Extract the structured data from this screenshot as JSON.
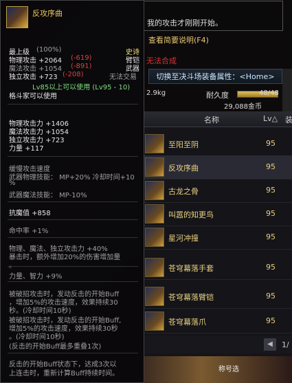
{
  "info_panel": {
    "tooltip_text": "我的攻击才刚刚开始。",
    "view_summary": "查看简要说明(F4)",
    "cannot_synth": "无法合成",
    "switch_button": "切换至决斗场装备属性：<Home>",
    "weight": "2.9kg",
    "durability_label": "耐久度",
    "durability_value": "48/48",
    "durability_fraction": 1.0,
    "price": "29,088金币"
  },
  "list": {
    "col_name": "名称",
    "col_lv": "Lv△",
    "col_extra": "装",
    "items": [
      {
        "name": "至阳至阴",
        "lv": "95"
      },
      {
        "name": "反攻序曲",
        "lv": "95"
      },
      {
        "name": "古龙之骨",
        "lv": "95"
      },
      {
        "name": "叫嚣的知更鸟",
        "lv": "95"
      },
      {
        "name": "星河冲撞",
        "lv": "95"
      },
      {
        "name": "苍穹幕落手套",
        "lv": "95"
      },
      {
        "name": "苍穹幕落臂铠",
        "lv": "95"
      },
      {
        "name": "苍穹幕落爪",
        "lv": "95"
      }
    ],
    "pager_prev": "◀",
    "page": "1/",
    "tab_label": "称号选"
  },
  "tooltip": {
    "title": "反攻序曲",
    "grade": "最上级",
    "grade_pct": "(100%)",
    "rarity": "史诗",
    "type1": "臂铠",
    "type2": "武器",
    "trade": "无法交易",
    "phys_atk": "物理攻击 +2064",
    "phys_atk_diff": "(-619)",
    "mag_atk": "魔法攻击 +1054",
    "mag_atk_diff": "(-891)",
    "ind_atk": "独立攻击 +723",
    "ind_atk_diff": "(-208)",
    "level_req": "Lv85以上可以使用 (Lv95 - 10)",
    "class_req": "格斗家可以使用",
    "stat1": "物理攻击力 +1406",
    "stat2": "魔法攻击力 +1054",
    "stat3": "独立攻击力 +723",
    "stat4": "力量 +117",
    "slow_speed": "缓慢攻击速度",
    "skill_line1": "武器物理技能： MP+20% 冷却时间+10",
    "skill_line1b": "%",
    "skill_line2": "武器魔法技能： MP-10%",
    "res": "抗魔值 +858",
    "hit": "命中率 +1%",
    "atk_up": "物理、魔法、独立攻击力 +40%",
    "crit": "暴击时，额外增加20%的伤害增加量",
    "crit2": "。",
    "str_int": "力量、智力 +9%",
    "eff1": "被破招攻击时，发动反击的开始Buff",
    "eff2": "，增加5%的攻击速度，效果持续30",
    "eff3": "秒。(冷却时间10秒)",
    "eff4": "被破招攻击时，发动反击的开始Buff,",
    "eff5": "增加5%的攻击速度，效果持续30秒",
    "eff6": "。(冷却时间10秒)",
    "eff7": "(反击的开始Buff最多重叠1次)",
    "eff8": "反击的开始Buff状态下，达成3次以",
    "eff9": "上连击时，重新计算Buff持续时间。"
  }
}
